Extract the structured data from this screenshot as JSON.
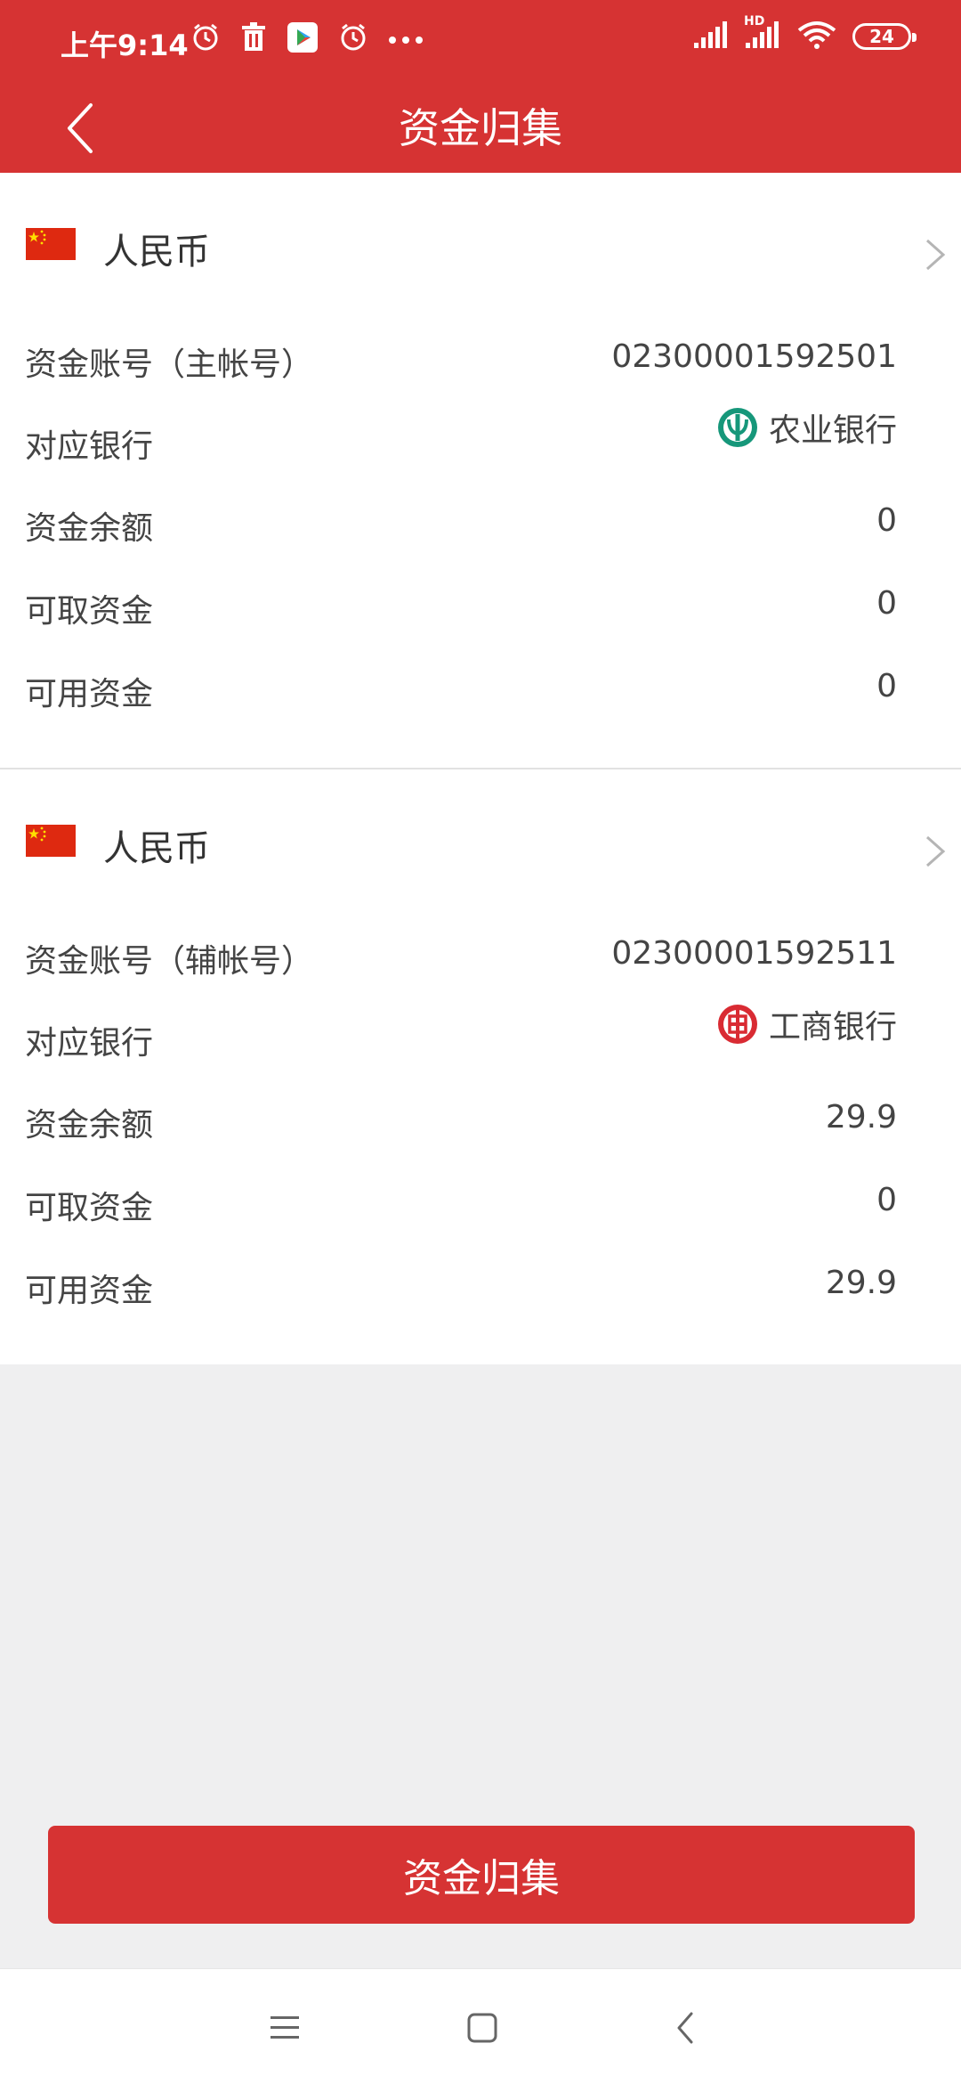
{
  "status_bar": {
    "time": "上午9:14",
    "battery": "24",
    "icons_left": [
      "alarm-icon",
      "trash-icon",
      "play-store-icon",
      "clock-icon",
      "more-dots-icon"
    ],
    "icons_right": [
      "signal-icon",
      "hd-signal-icon",
      "wifi-icon",
      "battery-icon"
    ],
    "hd_label": "HD"
  },
  "header": {
    "title": "资金归集",
    "back_icon": "chevron-left-icon"
  },
  "accounts": [
    {
      "currency": "人民币",
      "rows": [
        {
          "label": "资金账号（主帐号）",
          "value": "02300001592501"
        },
        {
          "label": "对应银行",
          "value": "农业银行",
          "bank_icon": "abc-bank-icon"
        },
        {
          "label": "资金余额",
          "value": "0"
        },
        {
          "label": "可取资金",
          "value": "0"
        },
        {
          "label": "可用资金",
          "value": "0"
        }
      ]
    },
    {
      "currency": "人民币",
      "rows": [
        {
          "label": "资金账号（辅帐号）",
          "value": "02300001592511"
        },
        {
          "label": "对应银行",
          "value": "工商银行",
          "bank_icon": "icbc-bank-icon"
        },
        {
          "label": "资金余额",
          "value": "29.9"
        },
        {
          "label": "可取资金",
          "value": "0"
        },
        {
          "label": "可用资金",
          "value": "29.9"
        }
      ]
    }
  ],
  "action_button": {
    "label": "资金归集"
  },
  "colors": {
    "brand_red": "#d63333",
    "abc_green": "#16977a",
    "icbc_red": "#d92b33"
  }
}
